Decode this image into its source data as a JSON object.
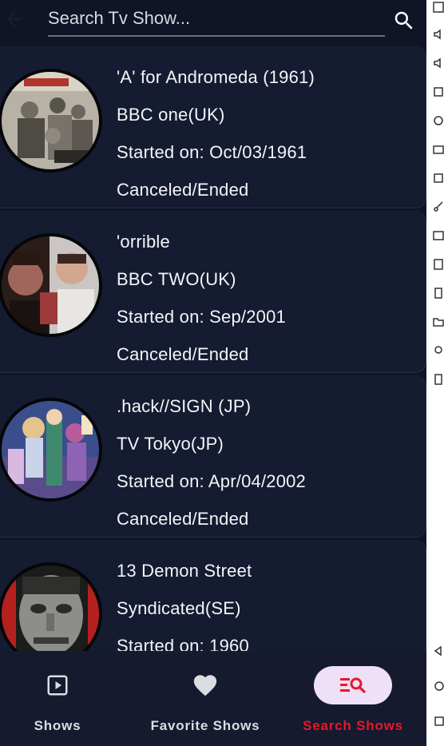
{
  "search": {
    "placeholder": "Search Tv Show..."
  },
  "shows": [
    {
      "title": "'A' for Andromeda (1961)",
      "network": "BBC one(UK)",
      "started": "Started on: Oct/03/1961",
      "status": "Canceled/Ended"
    },
    {
      "title": "'orrible",
      "network": "BBC TWO(UK)",
      "started": "Started on: Sep/2001",
      "status": "Canceled/Ended"
    },
    {
      "title": ".hack//SIGN (JP)",
      "network": "TV Tokyo(JP)",
      "started": "Started on: Apr/04/2002",
      "status": "Canceled/Ended"
    },
    {
      "title": "13 Demon Street",
      "network": "Syndicated(SE)",
      "started": "Started on: 1960",
      "status": ""
    }
  ],
  "nav": {
    "items": [
      {
        "label": "Shows",
        "icon": "play-square-icon",
        "active": false
      },
      {
        "label": "Favorite Shows",
        "icon": "heart-icon",
        "active": false
      },
      {
        "label": "Search Shows",
        "icon": "list-search-icon",
        "active": true
      }
    ]
  },
  "colors": {
    "background": "#0f1427",
    "card": "#151b31",
    "accent": "#e8172a",
    "pill": "#ede0f7",
    "nav_inactive": "#dcdde3"
  }
}
